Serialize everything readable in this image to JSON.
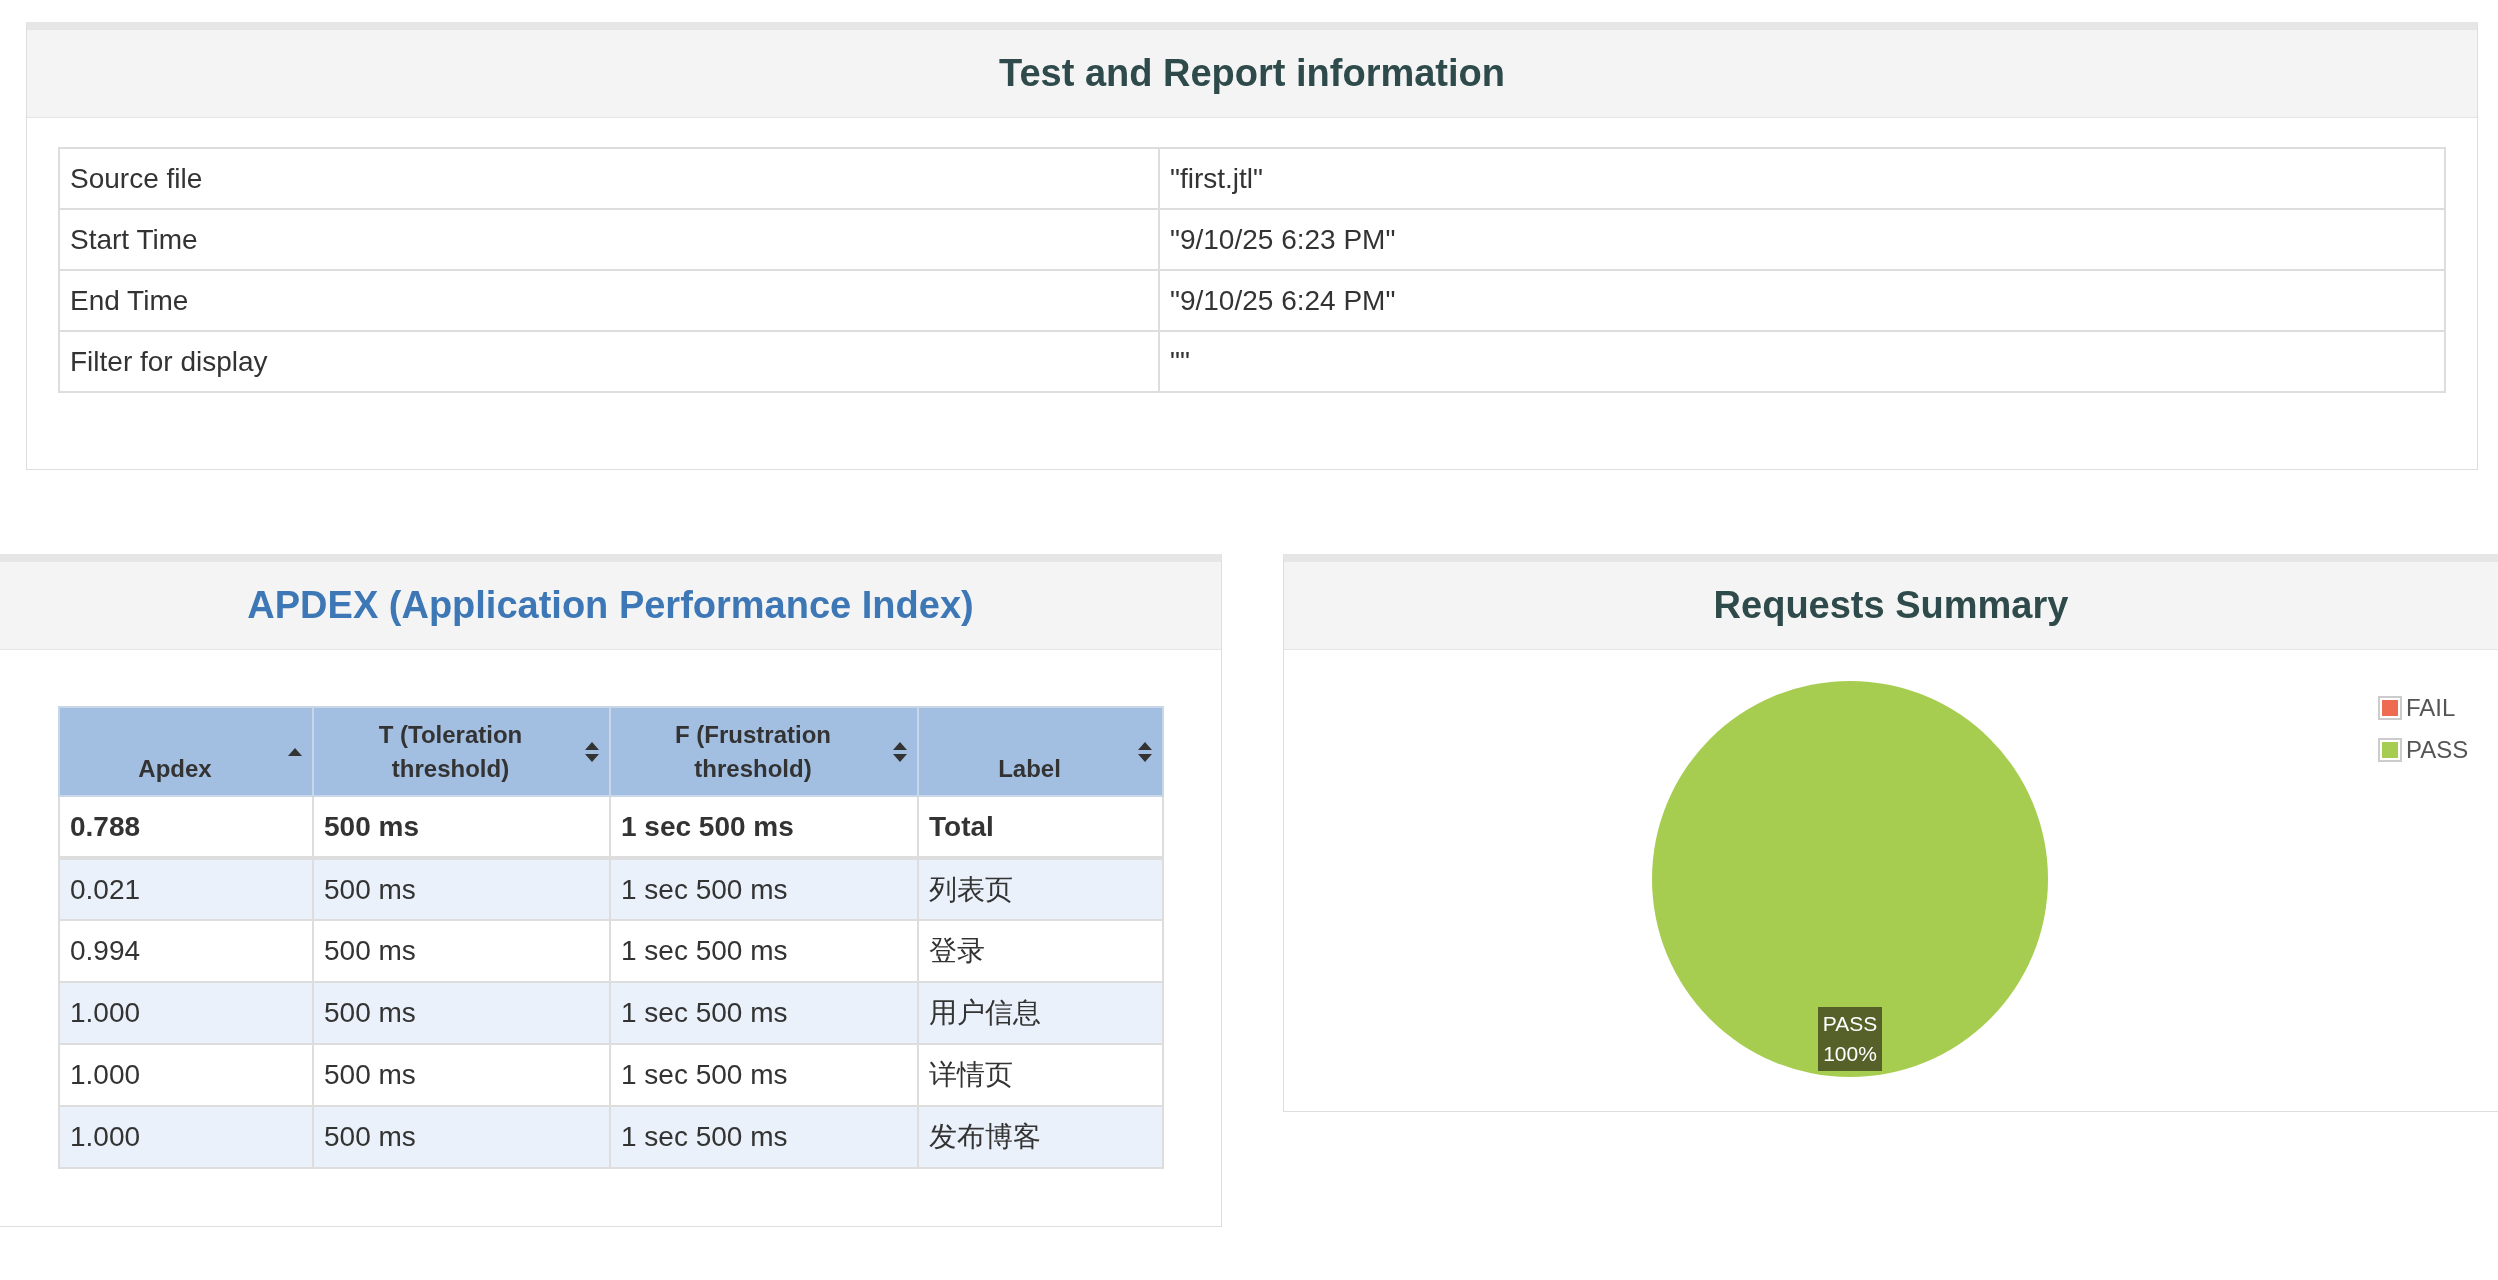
{
  "report_info": {
    "title": "Test and Report information",
    "rows": [
      {
        "name": "Source file",
        "value": "\"first.jtl\""
      },
      {
        "name": "Start Time",
        "value": "\"9/10/25 6:23 PM\""
      },
      {
        "name": "End Time",
        "value": "\"9/10/25 6:24 PM\""
      },
      {
        "name": "Filter for display",
        "value": "\"\""
      }
    ]
  },
  "apdex": {
    "title": "APDEX (Application Performance Index)",
    "columns": [
      {
        "label": "Apdex",
        "sorted": true
      },
      {
        "label": "T (Toleration threshold)",
        "sorted": false
      },
      {
        "label": "F (Frustration threshold)",
        "sorted": false
      },
      {
        "label": "Label",
        "sorted": false
      }
    ],
    "rows": [
      {
        "kind": "total",
        "cells": [
          "0.788",
          "500 ms",
          "1 sec 500 ms",
          "Total"
        ]
      },
      {
        "kind": "item",
        "cells": [
          "0.021",
          "500 ms",
          "1 sec 500 ms",
          "列表页"
        ]
      },
      {
        "kind": "item",
        "cells": [
          "0.994",
          "500 ms",
          "1 sec 500 ms",
          "登录"
        ]
      },
      {
        "kind": "item",
        "cells": [
          "1.000",
          "500 ms",
          "1 sec 500 ms",
          "用户信息"
        ]
      },
      {
        "kind": "item",
        "cells": [
          "1.000",
          "500 ms",
          "1 sec 500 ms",
          "详情页"
        ]
      },
      {
        "kind": "item",
        "cells": [
          "1.000",
          "500 ms",
          "1 sec 500 ms",
          "发布博客"
        ]
      }
    ]
  },
  "requests_summary": {
    "title": "Requests Summary",
    "legend": [
      {
        "color": "#ee6b52"
      },
      {
        "color": "#a6cd4f"
      }
    ],
    "chart_data": {
      "type": "pie",
      "categories": [
        "FAIL",
        "PASS"
      ],
      "values": [
        0,
        100
      ],
      "value_labels": [
        null,
        "PASS 100%"
      ]
    }
  }
}
